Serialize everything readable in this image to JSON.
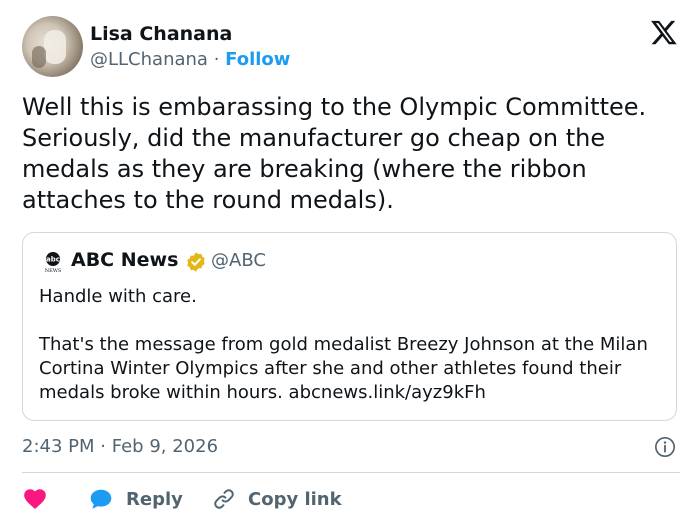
{
  "author": {
    "name": "Lisa Chanana",
    "handle": "@LLChanana",
    "separator": "·",
    "follow_label": "Follow"
  },
  "icons": {
    "platform_logo": "x-logo-icon",
    "verified_badge": "verified-badge-icon",
    "info": "info-icon",
    "like": "heart-icon",
    "reply": "reply-bubble-icon",
    "copy_link": "link-icon"
  },
  "tweet": {
    "text": "Well this is embarassing to the Olympic Committee. Seriously, did the manufacturer go cheap on the medals as they are breaking (where the ribbon attaches to the round medals)."
  },
  "quoted": {
    "logo_text": "NEWS",
    "name": "ABC News",
    "handle": "@ABC",
    "text": "Handle with care.\n\nThat's the message from gold medalist Breezy Johnson at the Milan Cortina Winter Olympics after she and other athletes found their medals broke within hours. abcnews.link/ayz9kFh"
  },
  "meta": {
    "time": "2:43 PM",
    "separator": "·",
    "date": "Feb 9, 2026"
  },
  "actions": {
    "reply_label": "Reply",
    "copy_link_label": "Copy link"
  },
  "colors": {
    "accent": "#1d9bf0",
    "like": "#f91880",
    "verified": "#e2b719",
    "text_secondary": "#536471",
    "border": "#cfd9de"
  }
}
